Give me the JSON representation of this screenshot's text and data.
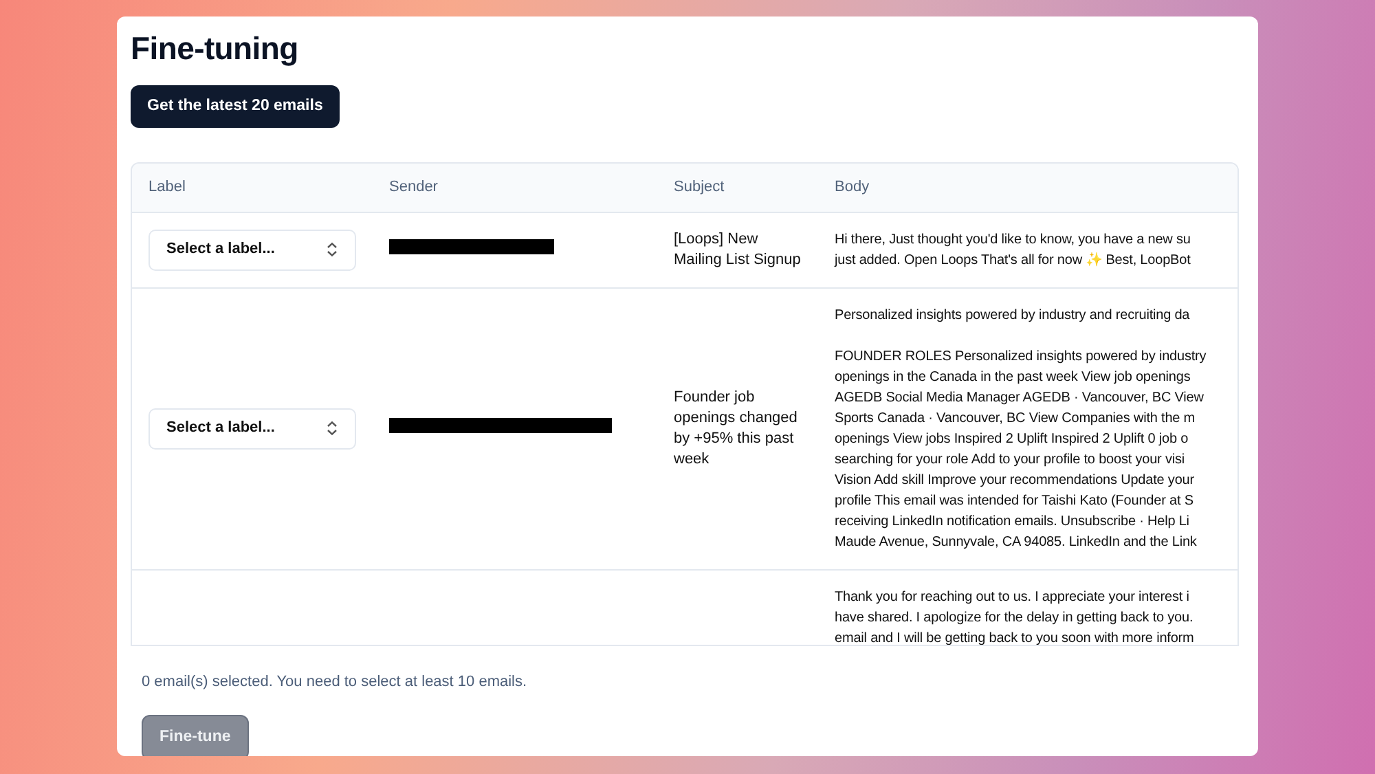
{
  "title": "Fine-tuning",
  "fetch_button": "Get the latest 20 emails",
  "table": {
    "columns": [
      "Label",
      "Sender",
      "Subject",
      "Body"
    ],
    "rows": [
      {
        "label_placeholder": "Select a label...",
        "sender_redacted": true,
        "subject": "[Loops] New Mailing List Signup",
        "body": [
          [
            "Hi there, Just thought you'd like to know, you have a new su",
            "just added. Open Loops That's all for now ✨ Best, LoopBot"
          ]
        ]
      },
      {
        "label_placeholder": "Select a label...",
        "sender_redacted": true,
        "subject": "Founder job openings changed by +95% this past week",
        "body": [
          [
            "Personalized insights powered by industry and recruiting da"
          ],
          [
            "FOUNDER ROLES Personalized insights powered by industry",
            "openings in the Canada in the past week View job openings",
            "AGEDB Social Media Manager AGEDB · Vancouver, BC View",
            "Sports Canada · Vancouver, BC View Companies with the m",
            "openings View jobs Inspired 2 Uplift Inspired 2 Uplift 0 job o",
            "searching for your role Add to your profile to boost your visi",
            "Vision Add skill Improve your recommendations Update your",
            "profile This email was intended for Taishi Kato (Founder at S",
            "receiving LinkedIn notification emails. Unsubscribe · Help Li",
            "Maude Avenue, Sunnyvale, CA 94085. LinkedIn and the Link"
          ]
        ]
      },
      {
        "body": [
          [
            "Thank you for reaching out to us. I appreciate your interest i",
            "have shared. I apologize for the delay in getting back to you.",
            "email and I will be getting back to you soon with more inform"
          ]
        ]
      }
    ]
  },
  "selection_note": "0 email(s) selected. You need to select at least 10 emails.",
  "finetune_button": {
    "label": "Fine-tune",
    "disabled": true
  }
}
